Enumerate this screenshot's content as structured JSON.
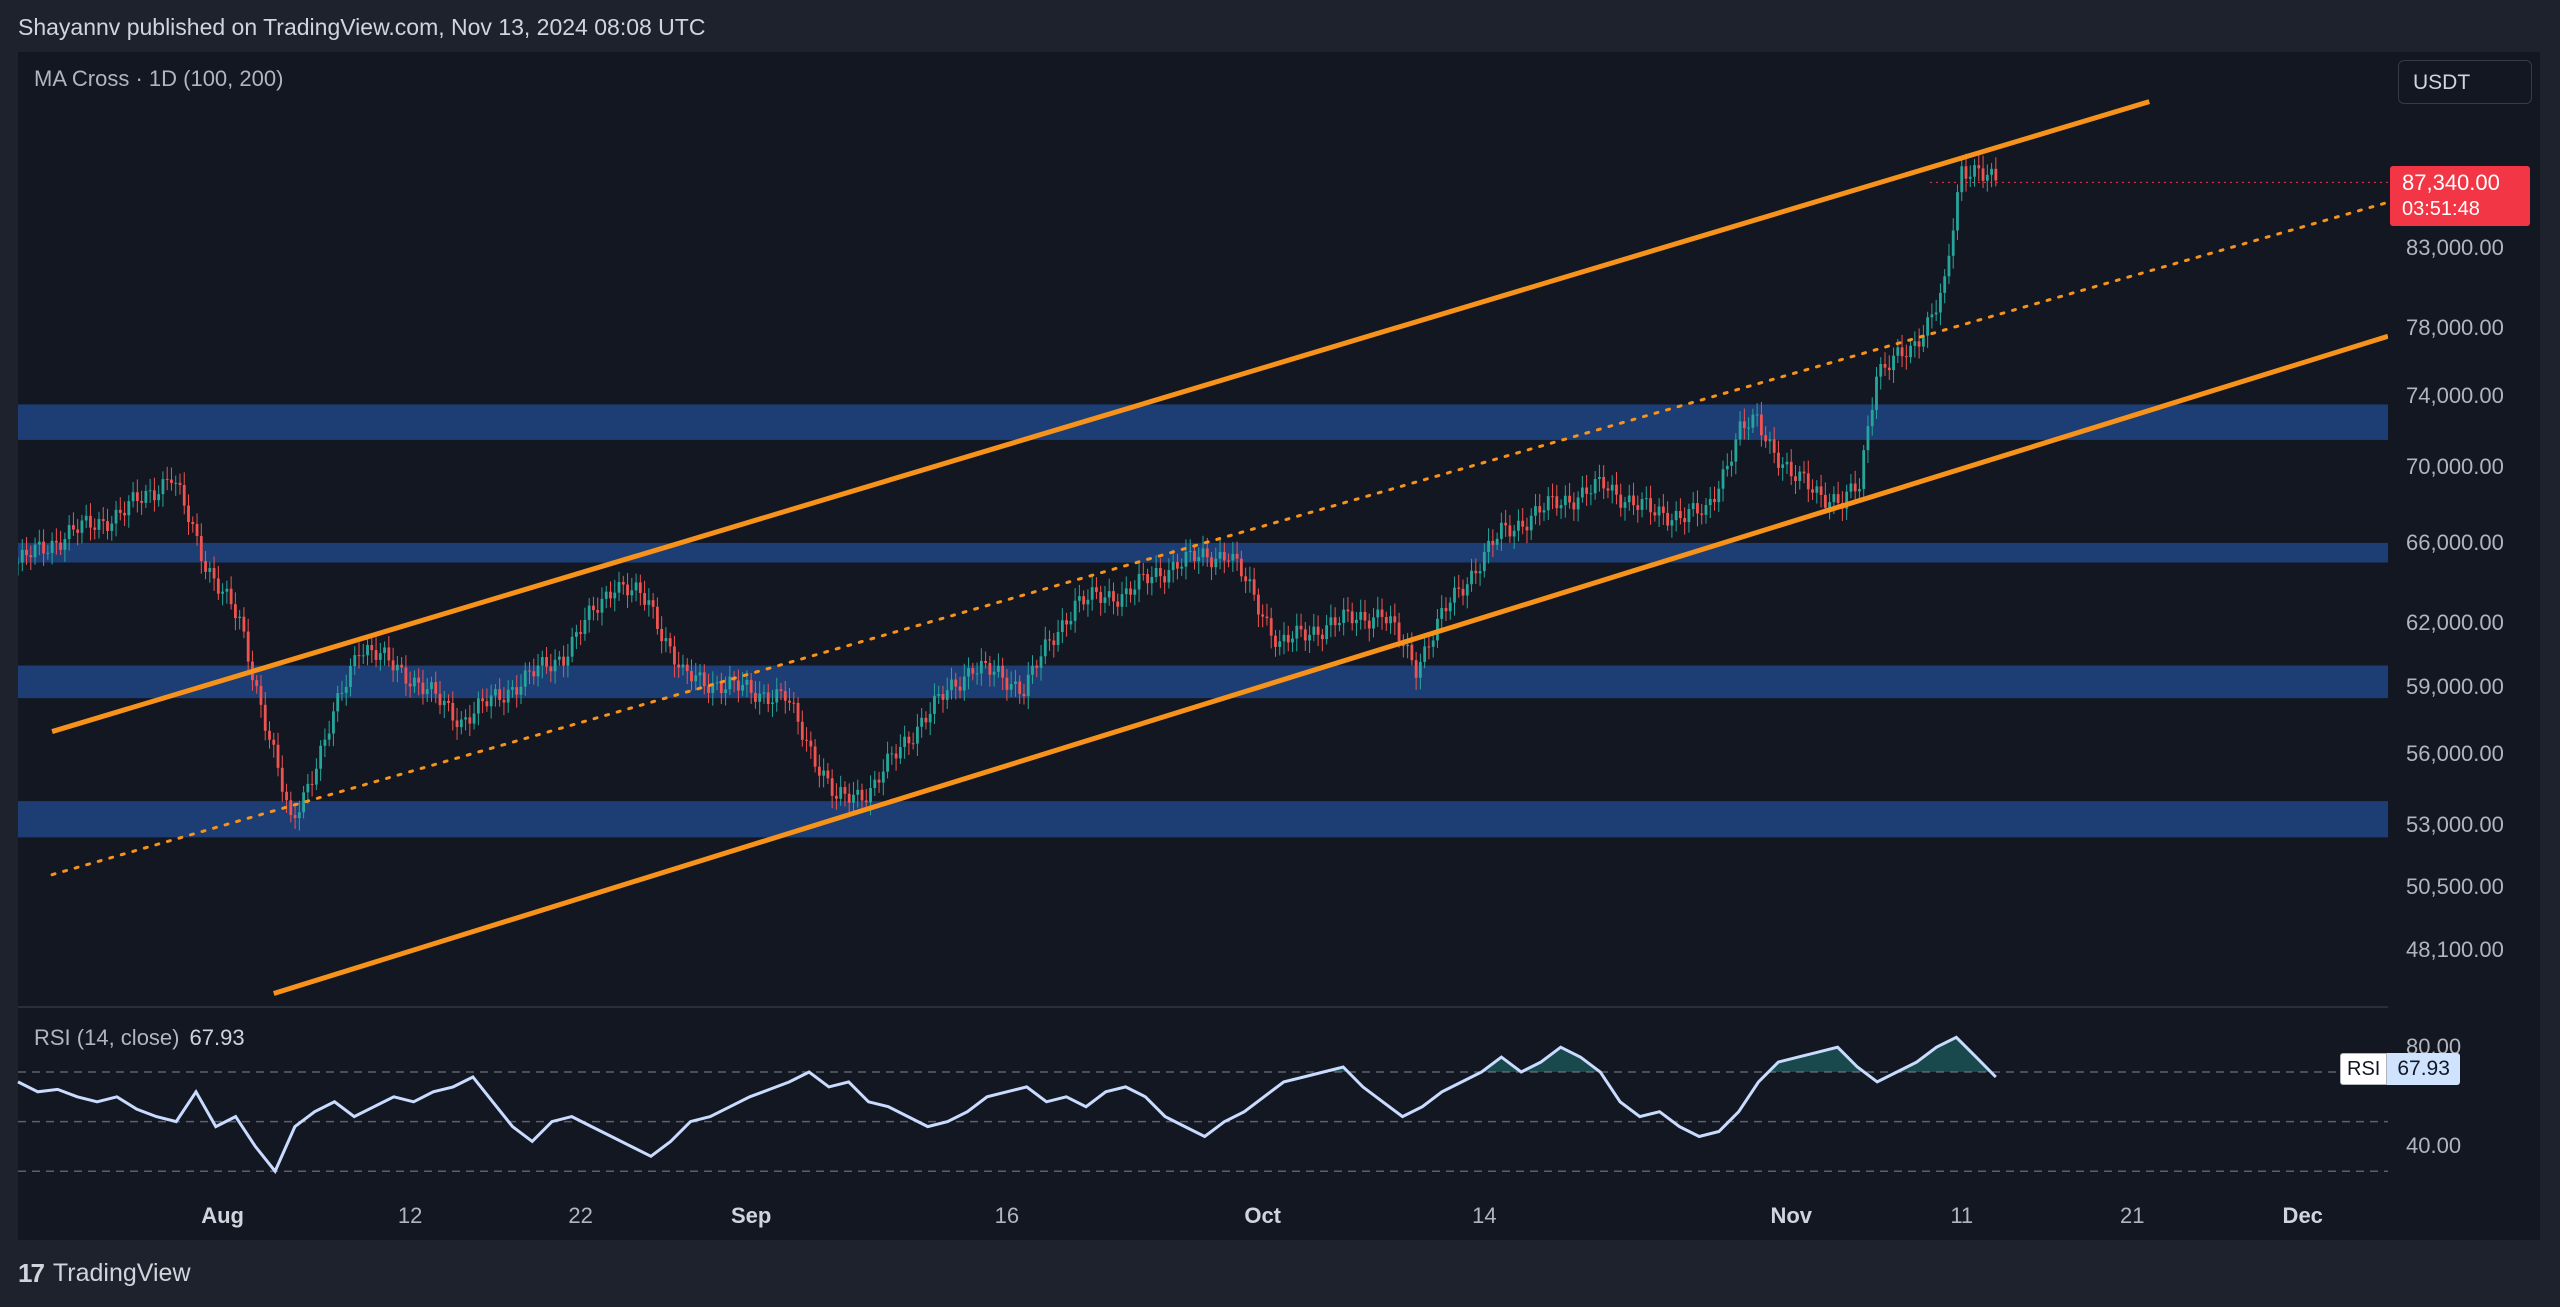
{
  "header": {
    "published": "Shayannv published on TradingView.com, Nov 13, 2024 08:08 UTC"
  },
  "indicator": {
    "label": "MA Cross · 1D (100, 200)"
  },
  "currency": "USDT",
  "price_axis": {
    "ticks": [
      "83,000.00",
      "78,000.00",
      "74,000.00",
      "70,000.00",
      "66,000.00",
      "62,000.00",
      "59,000.00",
      "56,000.00",
      "53,000.00",
      "50,500.00",
      "48,100.00"
    ],
    "current_price": "87,340.00",
    "countdown": "03:51:48"
  },
  "rsi": {
    "label": "RSI (14, close)",
    "value": "67.93",
    "tag_name": "RSI",
    "ticks": [
      "80.00",
      "40.00"
    ]
  },
  "time_axis": {
    "labels": [
      {
        "text": "Aug",
        "major": true
      },
      {
        "text": "12",
        "major": false
      },
      {
        "text": "22",
        "major": false
      },
      {
        "text": "Sep",
        "major": true
      },
      {
        "text": "16",
        "major": false
      },
      {
        "text": "Oct",
        "major": true
      },
      {
        "text": "14",
        "major": false
      },
      {
        "text": "Nov",
        "major": true
      },
      {
        "text": "11",
        "major": false
      },
      {
        "text": "21",
        "major": false
      },
      {
        "text": "Dec",
        "major": true
      }
    ]
  },
  "footer": {
    "brand": "TradingView",
    "mark": "17"
  },
  "colors": {
    "up": "#26a69a",
    "down": "#ef5350",
    "channel": "#f7931a",
    "zone": "#1e3f7a",
    "rsi_line": "#c9dcff"
  },
  "chart_data": [
    {
      "type": "candlestick",
      "title": "",
      "x_range": [
        "2024-07-20",
        "2024-12-06"
      ],
      "y_range": [
        46500,
        90000
      ],
      "y_scale": "log",
      "last_close": 87340,
      "candles_description": "Daily candles: ~65000 mid-July, dip to ~49000 early Aug, recovery to ~64500 late Aug, ~53000 early Sep, ~66000 end Sep, ~60000 mid Oct, ~73500 end Oct, ~67500 early Nov, rally to ~89000 on Nov 12",
      "anchors": [
        {
          "date": "2024-07-20",
          "close": 65000
        },
        {
          "date": "2024-07-23",
          "close": 66500
        },
        {
          "date": "2024-07-26",
          "close": 67500
        },
        {
          "date": "2024-07-29",
          "close": 69500
        },
        {
          "date": "2024-07-31",
          "close": 65000
        },
        {
          "date": "2024-08-02",
          "close": 62000
        },
        {
          "date": "2024-08-05",
          "close": 53000
        },
        {
          "date": "2024-08-07",
          "close": 56500
        },
        {
          "date": "2024-08-09",
          "close": 61000
        },
        {
          "date": "2024-08-12",
          "close": 59500
        },
        {
          "date": "2024-08-15",
          "close": 57500
        },
        {
          "date": "2024-08-18",
          "close": 59000
        },
        {
          "date": "2024-08-21",
          "close": 60500
        },
        {
          "date": "2024-08-24",
          "close": 64000
        },
        {
          "date": "2024-08-26",
          "close": 63000
        },
        {
          "date": "2024-08-28",
          "close": 59500
        },
        {
          "date": "2024-08-31",
          "close": 59000
        },
        {
          "date": "2024-09-03",
          "close": 58500
        },
        {
          "date": "2024-09-06",
          "close": 54000
        },
        {
          "date": "2024-09-08",
          "close": 54500
        },
        {
          "date": "2024-09-11",
          "close": 57500
        },
        {
          "date": "2024-09-14",
          "close": 60000
        },
        {
          "date": "2024-09-17",
          "close": 59000
        },
        {
          "date": "2024-09-20",
          "close": 63000
        },
        {
          "date": "2024-09-23",
          "close": 63500
        },
        {
          "date": "2024-09-26",
          "close": 65000
        },
        {
          "date": "2024-09-29",
          "close": 65500
        },
        {
          "date": "2024-10-02",
          "close": 61000
        },
        {
          "date": "2024-10-05",
          "close": 62000
        },
        {
          "date": "2024-10-08",
          "close": 62500
        },
        {
          "date": "2024-10-10",
          "close": 60000
        },
        {
          "date": "2024-10-12",
          "close": 63000
        },
        {
          "date": "2024-10-15",
          "close": 66500
        },
        {
          "date": "2024-10-18",
          "close": 68000
        },
        {
          "date": "2024-10-21",
          "close": 69000
        },
        {
          "date": "2024-10-24",
          "close": 67500
        },
        {
          "date": "2024-10-27",
          "close": 67500
        },
        {
          "date": "2024-10-29",
          "close": 72000
        },
        {
          "date": "2024-10-30",
          "close": 72500
        },
        {
          "date": "2024-11-01",
          "close": 69500
        },
        {
          "date": "2024-11-04",
          "close": 68000
        },
        {
          "date": "2024-11-05",
          "close": 69000
        },
        {
          "date": "2024-11-06",
          "close": 75500
        },
        {
          "date": "2024-11-08",
          "close": 76500
        },
        {
          "date": "2024-11-10",
          "close": 80500
        },
        {
          "date": "2024-11-11",
          "close": 88000
        },
        {
          "date": "2024-11-12",
          "close": 88500
        },
        {
          "date": "2024-11-13",
          "close": 87340
        }
      ],
      "horizontal_zones": [
        [
          71500,
          73500
        ],
        [
          65000,
          66000
        ],
        [
          58500,
          60000
        ],
        [
          52500,
          54000
        ]
      ],
      "channel_lines": [
        {
          "style": "solid",
          "from": {
            "date": "2024-07-22",
            "price": 57000
          },
          "to": {
            "date": "2024-11-22",
            "price": 93000
          }
        },
        {
          "style": "dotted",
          "from": {
            "date": "2024-07-22",
            "price": 51000
          },
          "to": {
            "date": "2024-12-06",
            "price": 86000
          }
        },
        {
          "style": "solid",
          "from": {
            "date": "2024-08-04",
            "price": 46500
          },
          "to": {
            "date": "2024-12-06",
            "price": 77500
          }
        }
      ]
    },
    {
      "type": "line",
      "title": "",
      "series": [
        {
          "name": "RSI",
          "values": [
            66,
            62,
            63,
            60,
            58,
            60,
            55,
            52,
            50,
            62,
            48,
            52,
            40,
            30,
            48,
            54,
            58,
            52,
            56,
            60,
            58,
            62,
            64,
            68,
            58,
            48,
            42,
            50,
            52,
            48,
            44,
            40,
            36,
            42,
            50,
            52,
            56,
            60,
            63,
            66,
            70,
            64,
            66,
            58,
            56,
            52,
            48,
            50,
            54,
            60,
            62,
            64,
            58,
            60,
            56,
            62,
            64,
            60,
            52,
            48,
            44,
            50,
            54,
            60,
            66,
            68,
            70,
            72,
            64,
            58,
            52,
            56,
            62,
            66,
            70,
            76,
            70,
            74,
            80,
            76,
            70,
            58,
            52,
            54,
            48,
            44,
            46,
            54,
            66,
            74,
            76,
            78,
            80,
            72,
            66,
            70,
            74,
            80,
            84,
            76,
            68
          ]
        }
      ],
      "ylim": [
        20,
        95
      ],
      "reference_levels": [
        70,
        50,
        30
      ],
      "last_value": 67.93
    }
  ]
}
